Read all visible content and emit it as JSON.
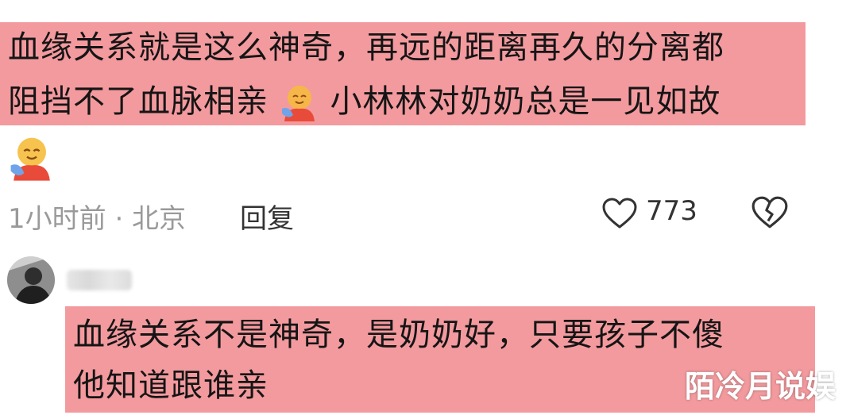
{
  "comment1": {
    "line1": "血缘关系就是这么神奇，再远的距离再久的分离都",
    "line2_before_emoji": "阻挡不了血脉相亲",
    "line2_after_emoji": "小林林对奶奶总是一见如故",
    "emoji_icon": "hug-emoji",
    "meta": "1小时前 · 北京",
    "reply_label": "回复",
    "like_count": "773",
    "like_icon": "heart-outline-icon",
    "dislike_icon": "broken-heart-icon"
  },
  "comment2": {
    "avatar_icon": "user-avatar",
    "line1": "血缘关系不是神奇，是奶奶好，只要孩子不傻",
    "line2": "他知道跟谁亲"
  },
  "watermark": "陌冷月说娱",
  "colors": {
    "highlight": "#f39a9e",
    "meta_gray": "#9a9a9a"
  }
}
